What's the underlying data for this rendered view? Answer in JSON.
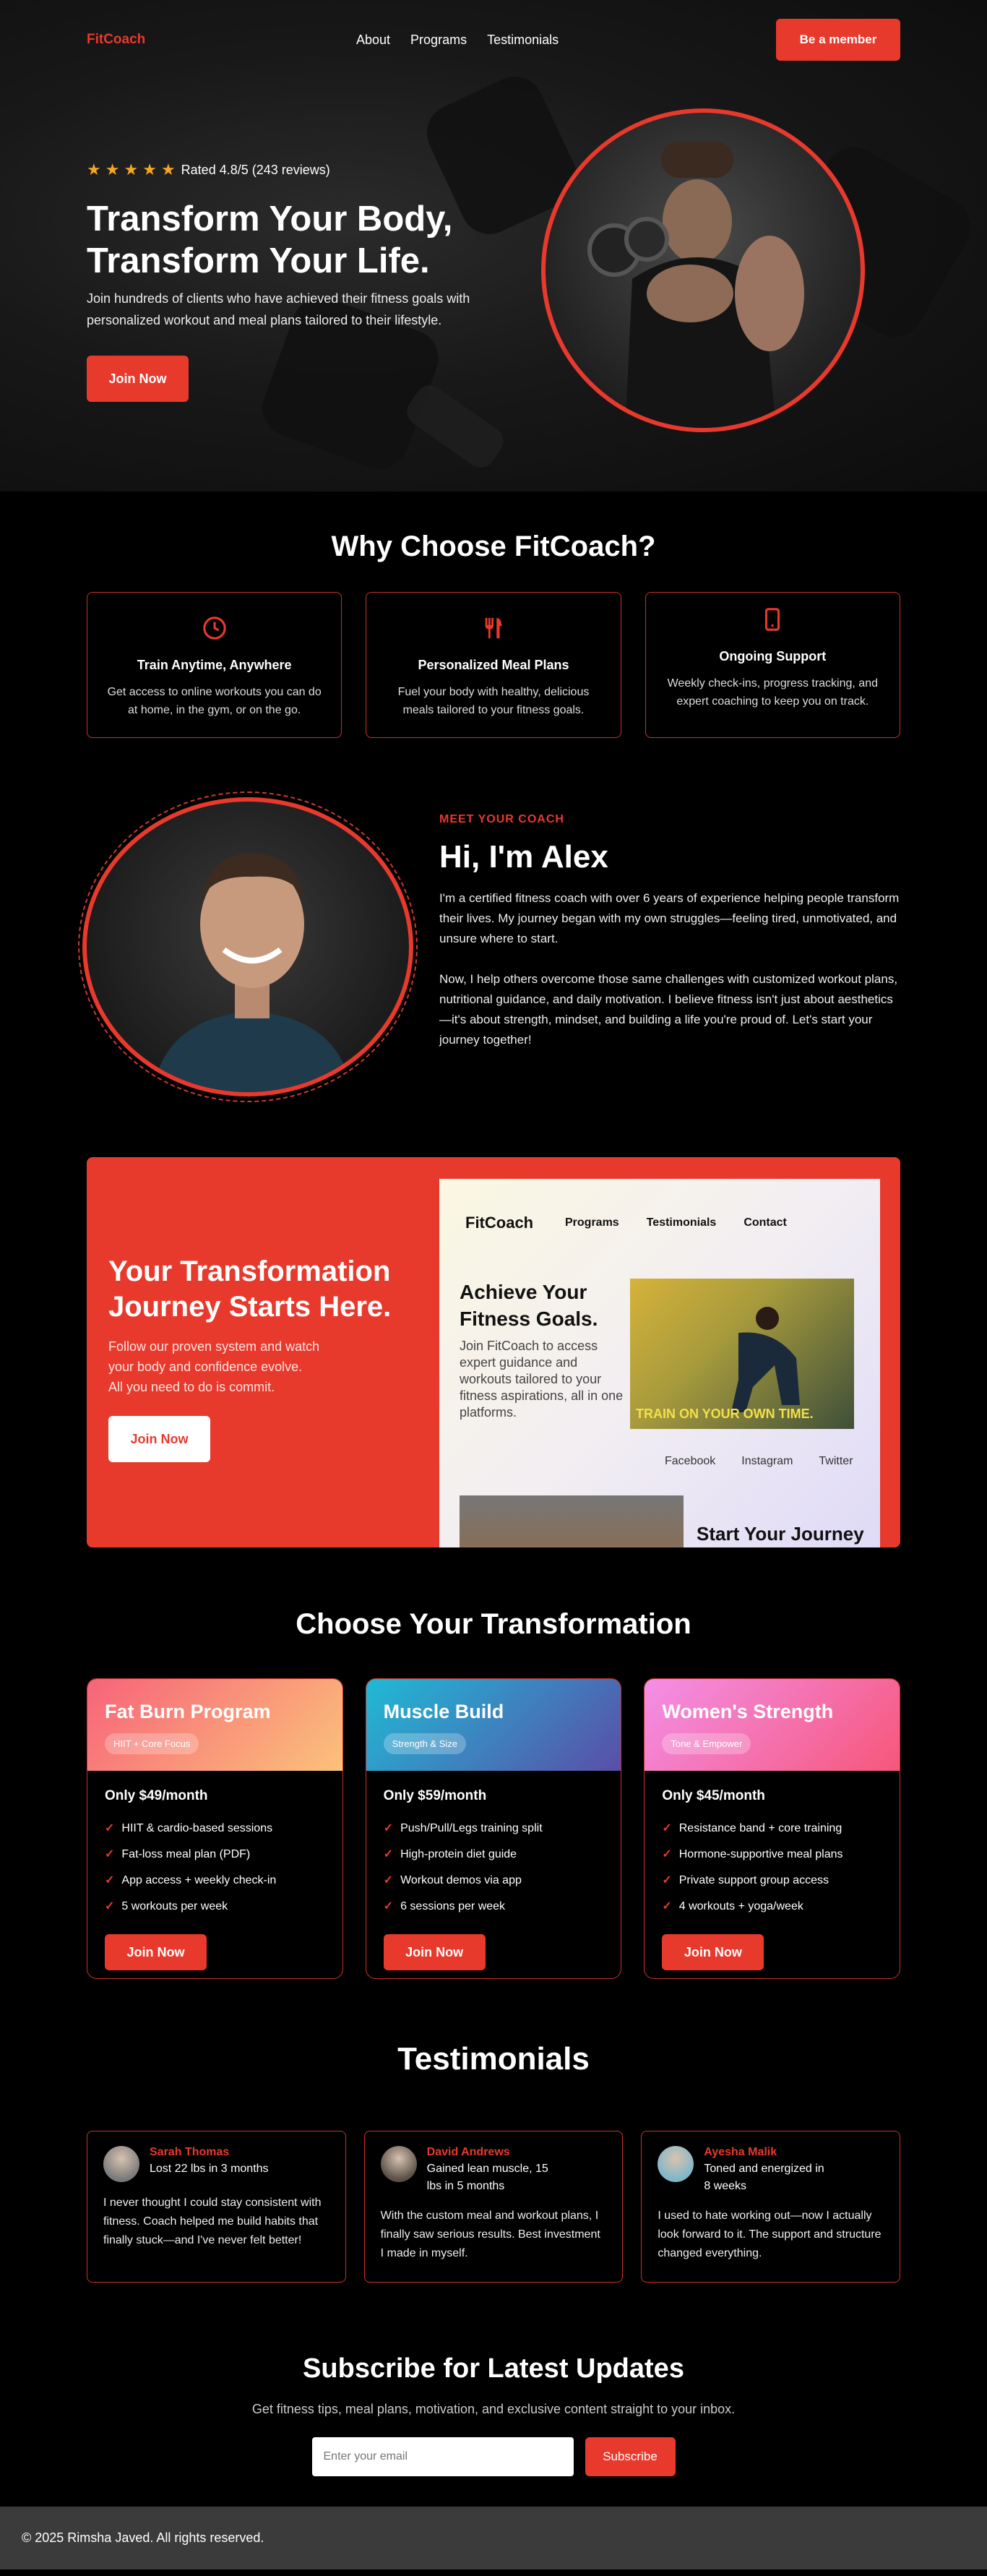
{
  "nav": {
    "brand": "FitCoach",
    "links": [
      "About",
      "Programs",
      "Testimonials"
    ],
    "cta": "Be a member"
  },
  "hero": {
    "rating_text": "Rated 4.8/5 (243 reviews)",
    "stars": 5,
    "title_line1": "Transform Your Body,",
    "title_line2": "Transform Your Life.",
    "description": "Join hundreds of clients who have achieved their fitness goals with personalized workout and meal plans tailored to their lifestyle.",
    "button": "Join Now"
  },
  "why": {
    "title": "Why Choose FitCoach?",
    "cards": [
      {
        "icon": "clock-icon",
        "title": "Train Anytime, Anywhere",
        "text": "Get access to online workouts you can do at home, in the gym, or on the go."
      },
      {
        "icon": "utensils-icon",
        "title": "Personalized Meal Plans",
        "text": "Fuel your body with healthy, delicious meals tailored to your fitness goals."
      },
      {
        "icon": "mobile-icon",
        "title": "Ongoing Support",
        "text": "Weekly check-ins, progress tracking, and expert coaching to keep you on track."
      }
    ]
  },
  "coach": {
    "eyebrow": "MEET YOUR COACH",
    "title": "Hi, I'm Alex",
    "para1": "I'm a certified fitness coach with over 6 years of experience helping people transform their lives. My journey began with my own struggles—feeling tired, unmotivated, and unsure where to start.",
    "para2": "Now, I help others overcome those same challenges with customized workout plans, nutritional guidance, and daily motivation. I believe fitness isn't just about aesthetics—it's about strength, mindset, and building a life you're proud of. Let's start your journey together!"
  },
  "cta": {
    "title": "Your Transformation Journey Starts Here.",
    "line1": "Follow our proven system and watch",
    "line2": "your body and confidence evolve.",
    "line3": "All you need to do is commit.",
    "button": "Join Now",
    "mock": {
      "brand": "FitCoach",
      "links": [
        "Programs",
        "Testimonials",
        "Contact"
      ],
      "heading": "Achieve Your Fitness Goals.",
      "text": "Join FitCoach to access expert guidance and workouts tailored to your fitness aspirations, all in one platforms.",
      "image_tag": "TRAIN ON YOUR OWN TIME.",
      "social": [
        "Facebook",
        "Instagram",
        "Twitter"
      ],
      "start": "Start Your Journey"
    }
  },
  "plans": {
    "title": "Choose Your Transformation",
    "items": [
      {
        "name": "Fat Burn Program",
        "badge": "HIIT + Core Focus",
        "price": "Only $49/month",
        "features": [
          "HIIT & cardio-based sessions",
          "Fat-loss meal plan (PDF)",
          "App access + weekly check-in",
          "5 workouts per week"
        ],
        "button": "Join Now",
        "grad_from": "#f7637a",
        "grad_to": "#fbc27a"
      },
      {
        "name": "Muscle Build",
        "badge": "Strength & Size",
        "price": "Only $59/month",
        "features": [
          "Push/Pull/Legs training split",
          "High-protein diet guide",
          "Workout demos via app",
          "6 sessions per week"
        ],
        "button": "Join Now",
        "grad_from": "#1fbad6",
        "grad_to": "#5a4ea8"
      },
      {
        "name": "Women's Strength",
        "badge": "Tone & Empower",
        "price": "Only $45/month",
        "features": [
          "Resistance band + core training",
          "Hormone-supportive meal plans",
          "Private support group access",
          "4 workouts + yoga/week"
        ],
        "button": "Join Now",
        "grad_from": "#f38fe8",
        "grad_to": "#f6577a"
      }
    ]
  },
  "testimonials": {
    "title": "Testimonials",
    "items": [
      {
        "name": "Sarah Thomas",
        "result": "Lost 22 lbs in 3 months",
        "quote": "I never thought I could stay consistent with fitness. Coach helped me build habits that finally stuck—and I've never felt better!",
        "avatar_color": "#7a7a7a"
      },
      {
        "name": "David Andrews",
        "result": "Gained lean muscle, 15 lbs in 5 months",
        "quote": "With the custom meal and workout plans, I finally saw serious results. Best investment I made in myself.",
        "avatar_color": "#5a5148"
      },
      {
        "name": "Ayesha Malik",
        "result": "Toned and energized in 8 weeks",
        "quote": "I used to hate working out—now I actually look forward to it. The support and structure changed everything.",
        "avatar_color": "#7fb7c9"
      }
    ]
  },
  "subscribe": {
    "title": "Subscribe for Latest Updates",
    "text": "Get fitness tips, meal plans, motivation, and exclusive content straight to your inbox.",
    "placeholder": "Enter your email",
    "button": "Subscribe"
  },
  "footer": {
    "text": "© 2025 Rimsha Javed. All rights reserved."
  },
  "colors": {
    "accent": "#e8392d",
    "background": "#000000",
    "footer": "#3b3b3b"
  }
}
